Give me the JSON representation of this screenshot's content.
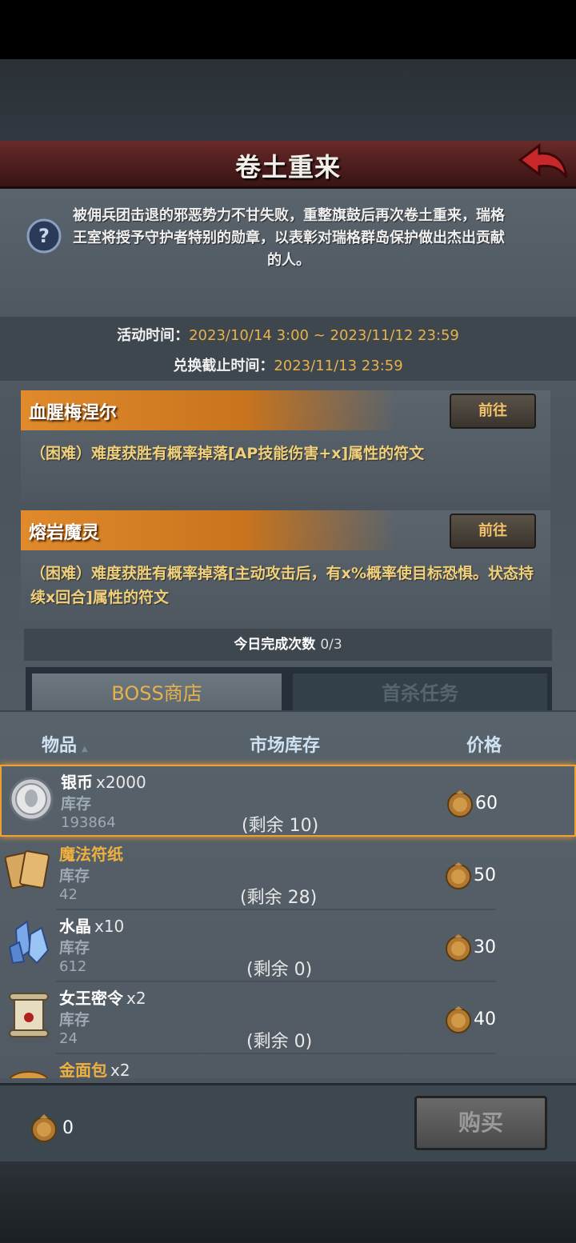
{
  "header": {
    "title": "卷土重来"
  },
  "description": "被佣兵团击退的邪恶势力不甘失败，重整旗鼓后再次卷土重来，瑞格王室将授予守护者特别的勋章，以表彰对瑞格群岛保护做出杰出贡献的人。",
  "event_time": {
    "label": "活动时间：",
    "value": "2023/10/14 3:00 ~ 2023/11/12 23:59"
  },
  "exchange_deadline": {
    "label": "兑换截止时间：",
    "value": "2023/11/13 23:59"
  },
  "bosses": [
    {
      "name": "血腥梅涅尔",
      "go_label": "前往",
      "desc": "（困难）难度获胜有概率掉落[AP技能伤害+x]属性的符文"
    },
    {
      "name": "熔岩魔灵",
      "go_label": "前往",
      "desc": "（困难）难度获胜有概率掉落[主动攻击后，有x%概率使目标恐惧。状态持续x回合]属性的符文"
    }
  ],
  "daily": {
    "label": "今日完成次数",
    "value": "0/3"
  },
  "tabs": {
    "shop": "BOSS商店",
    "first_kill": "首杀任务"
  },
  "columns": {
    "item": "物品",
    "sort_icon": "sort-ascending-icon",
    "stock": "市场库存",
    "price": "价格"
  },
  "items": [
    {
      "name": "银币",
      "qty": "x2000",
      "stock_label": "库存",
      "stock": "193864",
      "remain": "(剩余 10)",
      "price": "60",
      "icon": "silver-coin-icon",
      "name_color": "white"
    },
    {
      "name": "魔法符纸",
      "qty": "",
      "stock_label": "库存",
      "stock": "42",
      "remain": "(剩余 28)",
      "price": "50",
      "icon": "magic-paper-icon",
      "name_color": "gold"
    },
    {
      "name": "水晶",
      "qty": "x10",
      "stock_label": "库存",
      "stock": "612",
      "remain": "(剩余 0)",
      "price": "30",
      "icon": "crystal-icon",
      "name_color": "white"
    },
    {
      "name": "女王密令",
      "qty": "x2",
      "stock_label": "库存",
      "stock": "24",
      "remain": "(剩余 0)",
      "price": "40",
      "icon": "scroll-icon",
      "name_color": "white"
    },
    {
      "name": "金面包",
      "qty": "x2",
      "stock_label": "",
      "stock": "",
      "remain": "",
      "price": "",
      "icon": "bread-icon",
      "name_color": "gold"
    }
  ],
  "footer": {
    "balance": "0",
    "buy_label": "购买"
  },
  "colors": {
    "accent": "#e8b24a",
    "boss_bar": "#e08a2c",
    "selected_border": "#f0a030"
  }
}
